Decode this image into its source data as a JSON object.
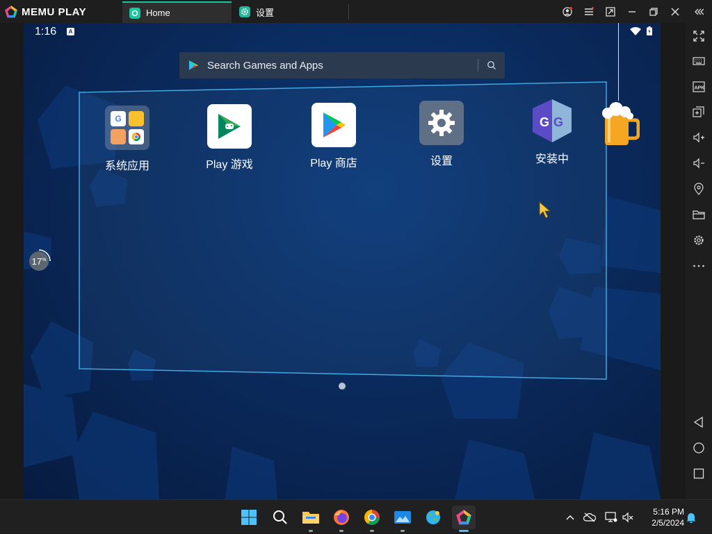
{
  "titlebar": {
    "app_name": "MEMU PLAY",
    "tabs": [
      {
        "label": "Home",
        "active": true
      },
      {
        "label": "设置",
        "active": false
      }
    ]
  },
  "android": {
    "status": {
      "time": "1:16",
      "badge": "A"
    },
    "search": {
      "placeholder": "Search Games and Apps"
    },
    "apps": [
      {
        "label": "系统应用",
        "icon": "system-apps-folder"
      },
      {
        "label": "Play 游戏",
        "icon": "play-games-icon"
      },
      {
        "label": "Play 商店",
        "icon": "play-store-icon"
      },
      {
        "label": "设置",
        "icon": "settings-icon"
      },
      {
        "label": "安装中",
        "icon": "game-guardian-icon"
      }
    ],
    "boost": {
      "value": "17",
      "unit": "%"
    },
    "page_indicator": {
      "pages": 1,
      "current": 1
    }
  },
  "sidebar": {
    "tools": [
      "fullscreen-icon",
      "keyboard-icon",
      "apk-icon",
      "add-window-icon",
      "volume-up-icon",
      "volume-down-icon",
      "location-icon",
      "folder-icon",
      "settings-icon",
      "more-icon",
      "back-icon",
      "home-icon",
      "recents-icon"
    ],
    "apk_label": "APK"
  },
  "taskbar": {
    "apps": [
      "start",
      "search",
      "file-explorer",
      "firefox",
      "chrome",
      "photos",
      "globe-app",
      "memu"
    ],
    "time": "5:16 PM",
    "date": "2/5/2024"
  },
  "colors": {
    "accent": "#19c8a0",
    "desktop_bg": "#0a2a5c",
    "glass_border": "#3fa9e0"
  }
}
